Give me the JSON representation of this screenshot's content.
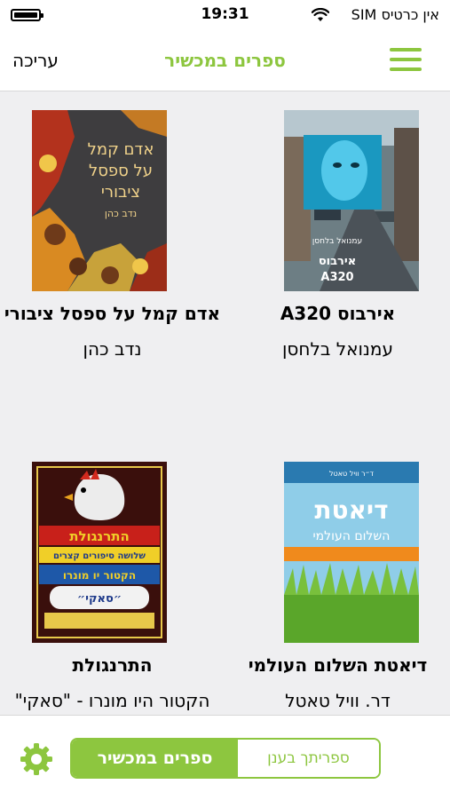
{
  "status_bar": {
    "carrier": "אין כרטיס SIM",
    "time": "19:31"
  },
  "nav": {
    "edit_label": "עריכה",
    "title": "ספרים במכשיר"
  },
  "books": [
    {
      "title": "אירבוס A320",
      "author": "עמנואל בלחסן",
      "cover_text": [
        "עמנואל בלחסן",
        "אירבוס",
        "A320"
      ]
    },
    {
      "title": "אדם קמל על ספסל ציבורי",
      "author": "נדב כהן",
      "cover_text": [
        "אדם קמל",
        "על ספסל",
        "ציבורי",
        "נדב כהן"
      ]
    },
    {
      "title": "דיאטת השלום העולמי",
      "author": "דר. וויל טאטל",
      "cover_text": [
        "ד״ר וויל טאטל",
        "דיאטת",
        "השלום העולמי"
      ]
    },
    {
      "title": "התרנגולת",
      "author": "הקטור היו מונרו - \"סאקי\"",
      "cover_text": [
        "התרנגולת",
        "שלושה סיפורים קצרים",
        "הקטור יו מונרו",
        "״סאקי״"
      ]
    }
  ],
  "bottom": {
    "segment_device": "ספרים במכשיר",
    "segment_cloud": "ספריתך בענן"
  },
  "colors": {
    "accent": "#8dc63f"
  }
}
